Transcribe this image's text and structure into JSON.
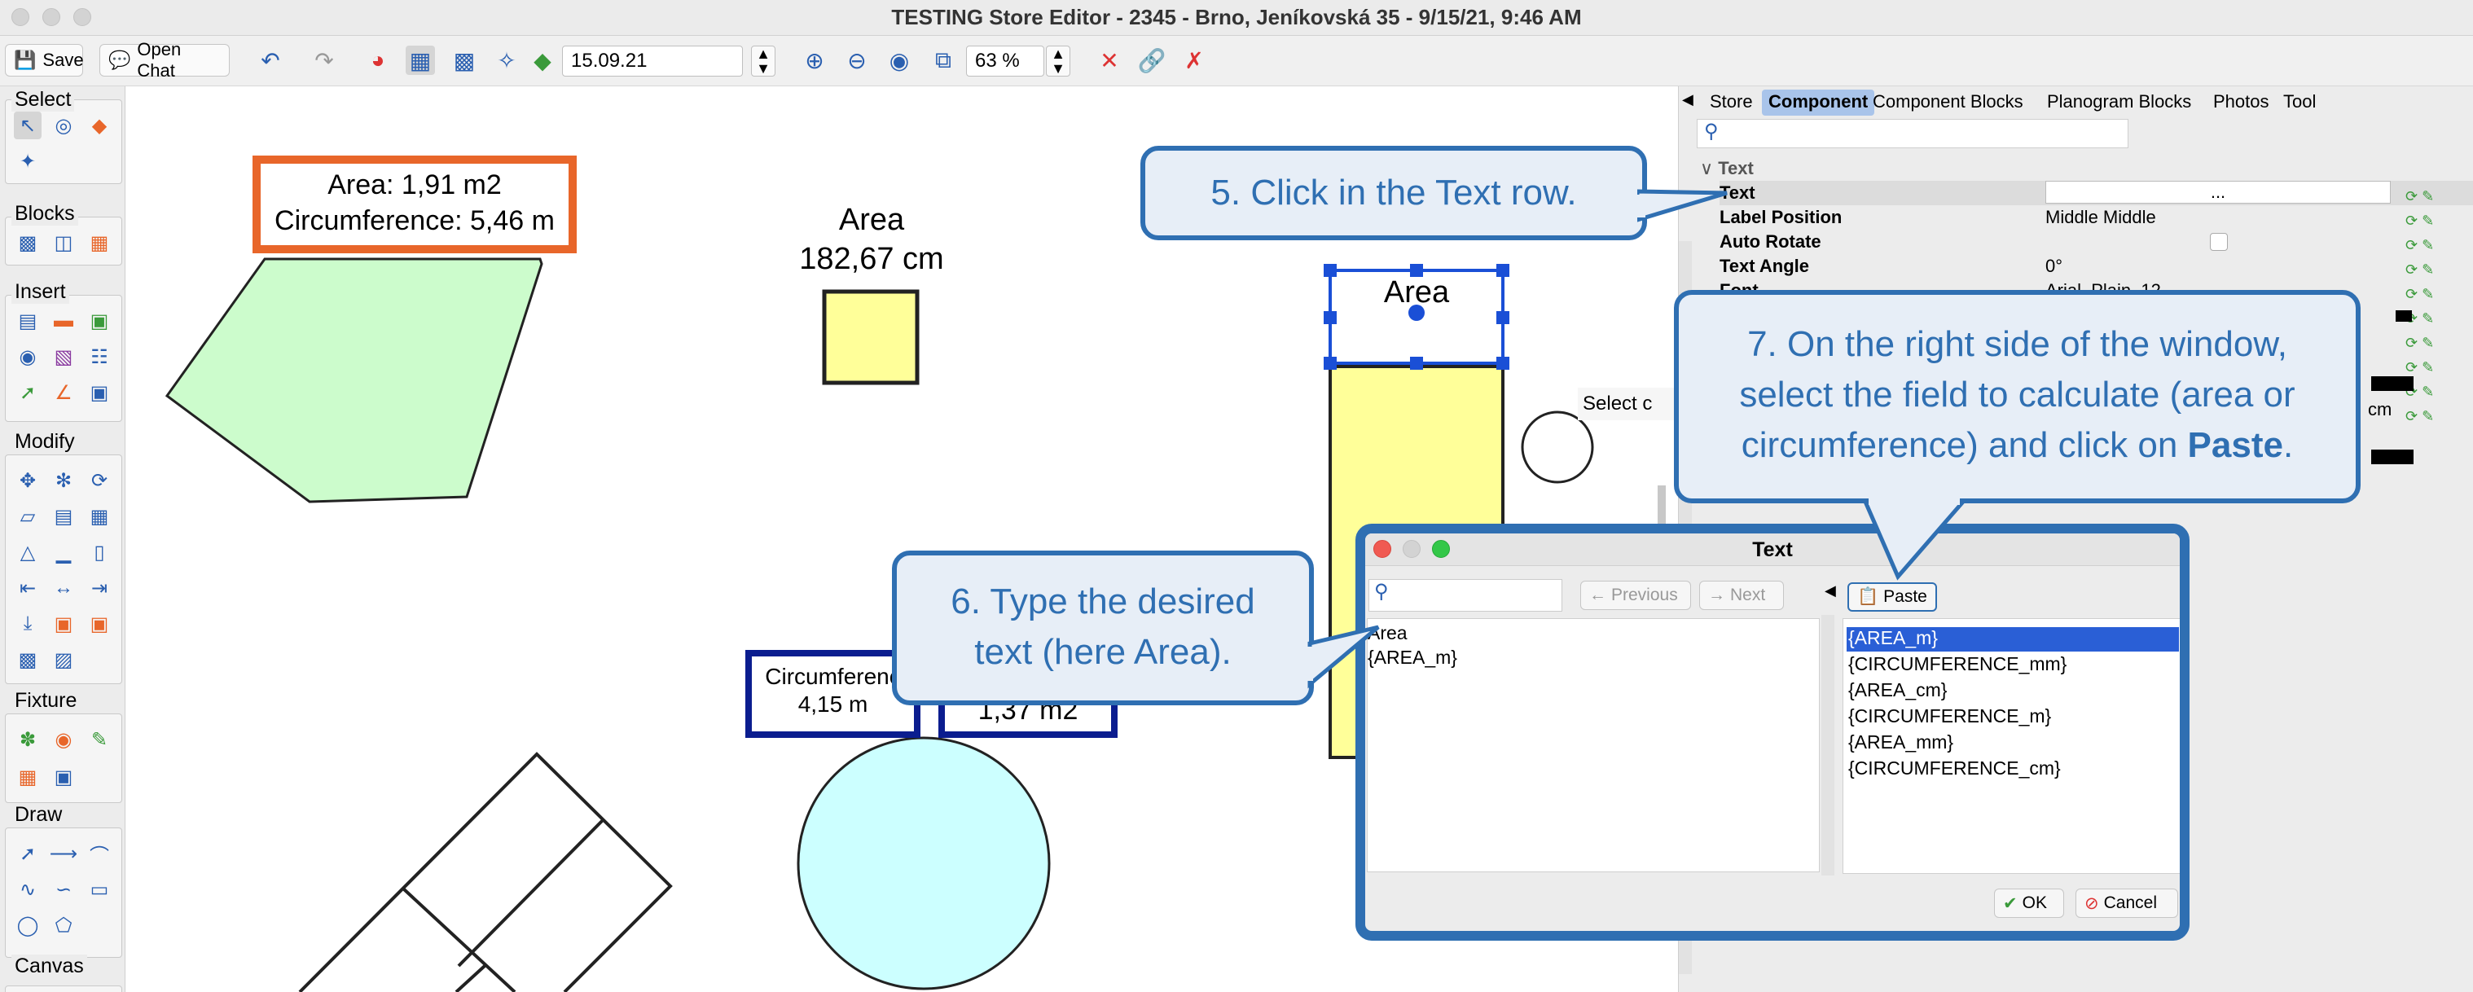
{
  "window": {
    "title": "TESTING Store Editor - 2345 - Brno, Jeníkovská 35 - 9/15/21, 9:46 AM"
  },
  "toolbar": {
    "save_label": "Save",
    "open_chat_label": "Open Chat",
    "date_value": "15.09.21",
    "zoom_value": "63 %"
  },
  "palette": {
    "select": "Select",
    "blocks": "Blocks",
    "insert": "Insert",
    "modify": "Modify",
    "fixture": "Fixture",
    "draw": "Draw",
    "canvas": "Canvas"
  },
  "canvas": {
    "area_box_line1": "Area: 1,91 m2",
    "area_box_line2": "Circumference: 5,46 m",
    "area_label_line1": "Area",
    "area_label_line2": "182,67 cm",
    "selected_text": "Area",
    "circ_box_line1": "Circumferenc",
    "circ_box_line2": "4,15 m",
    "area2_box_line2": "1,37 m2",
    "select_hint": "Select c"
  },
  "right_panel": {
    "tabs": [
      "Store",
      "Component",
      "Component Blocks",
      "Planogram Blocks",
      "Photos",
      "Tool"
    ],
    "section": "Text",
    "rows": [
      {
        "name": "Text",
        "value": "..."
      },
      {
        "name": "Label Position",
        "value": "Middle Middle"
      },
      {
        "name": "Auto Rotate",
        "value": ""
      },
      {
        "name": "Text Angle",
        "value": "0°"
      },
      {
        "name": "Font",
        "value": "Arial, Plain, 12"
      }
    ],
    "cm_label": "cm"
  },
  "callouts": {
    "c5": "5. Click in the Text row.",
    "c6_line1": "6. Type the desired",
    "c6_line2": "text (here Area).",
    "c7_line1": "7. On the right side of the window,",
    "c7_line2": "select the field to calculate (area or",
    "c7_line3_prefix": "circumference) and click on ",
    "c7_line3_bold": "Paste",
    "c7_line3_suffix": "."
  },
  "dialog": {
    "title": "Text",
    "previous_label": "Previous",
    "next_label": "Next",
    "paste_label": "Paste",
    "text_lines": [
      "Area",
      "{AREA_m}"
    ],
    "fields": [
      "{AREA_m}",
      "{CIRCUMFERENCE_mm}",
      "{AREA_cm}",
      "{CIRCUMFERENCE_m}",
      "{AREA_mm}",
      "{CIRCUMFERENCE_cm}"
    ],
    "ok_label": "OK",
    "cancel_label": "Cancel"
  },
  "colors": {
    "accent": "#2f6fb2",
    "highlight_orange": "#e8662a",
    "dark_blue": "#0b1d8f",
    "shape_green": "#ccfccc",
    "shape_yellow": "#ffff99",
    "shape_cyan": "#ccffff",
    "selection_blue": "#1a4fd6"
  }
}
